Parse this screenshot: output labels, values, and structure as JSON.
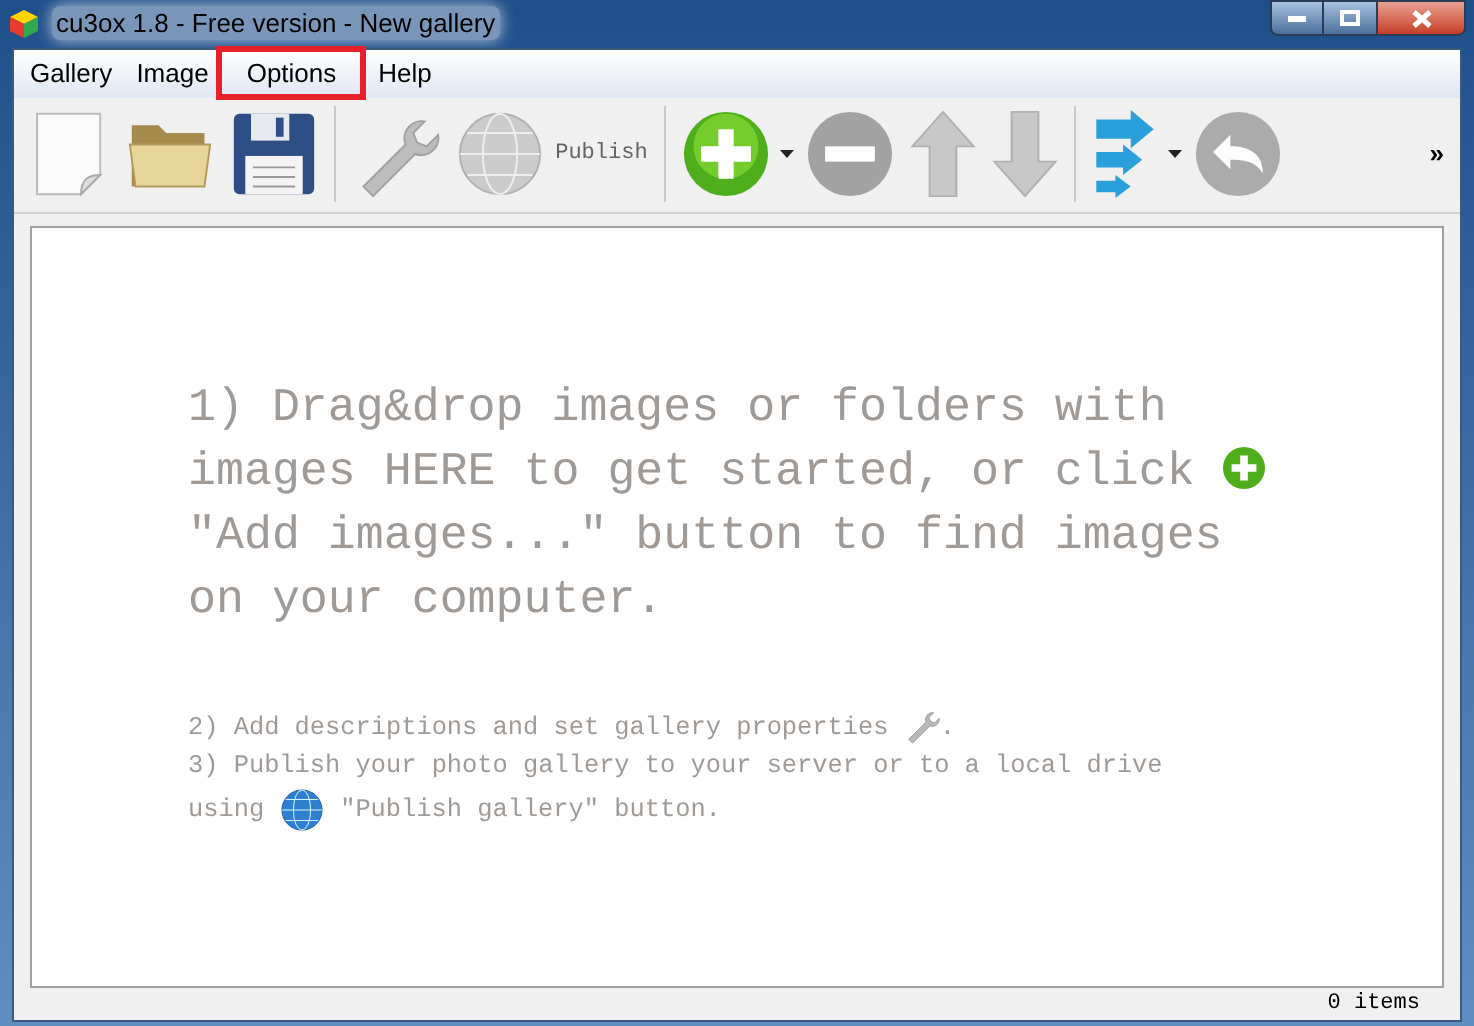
{
  "window": {
    "title": "cu3ox 1.8 - Free version - New gallery"
  },
  "menu": [
    {
      "label": "Gallery",
      "highlighted": false
    },
    {
      "label": "Image",
      "highlighted": false
    },
    {
      "label": "Options",
      "highlighted": true
    },
    {
      "label": "Help",
      "highlighted": false
    }
  ],
  "toolbar": [
    {
      "kind": "new"
    },
    {
      "kind": "open"
    },
    {
      "kind": "save"
    },
    {
      "kind": "separator"
    },
    {
      "kind": "settings",
      "disabled": true
    },
    {
      "kind": "publish",
      "disabled": true,
      "label": "Publish"
    },
    {
      "kind": "separator"
    },
    {
      "kind": "add",
      "disabled": false,
      "dropdown": true
    },
    {
      "kind": "remove",
      "disabled": true
    },
    {
      "kind": "up",
      "disabled": true
    },
    {
      "kind": "down",
      "disabled": true
    },
    {
      "kind": "separator"
    },
    {
      "kind": "export",
      "disabled": false,
      "dropdown": true
    },
    {
      "kind": "undo",
      "disabled": true
    },
    {
      "kind": "more",
      "label": "»"
    }
  ],
  "hint": {
    "step1_before": "1) Drag&drop images or folders with images HERE to get started, or click",
    "step1_after": "\"Add images...\" button to find images on your computer.",
    "step2_before": "2) Add descriptions and set gallery properties",
    "step2_after": ".",
    "step3_line": "3) Publish your photo gallery to your server or to a local drive",
    "step3_before": "using",
    "step3_after": "\"Publish gallery\" button."
  },
  "status_bar": {
    "count": "0 items"
  }
}
